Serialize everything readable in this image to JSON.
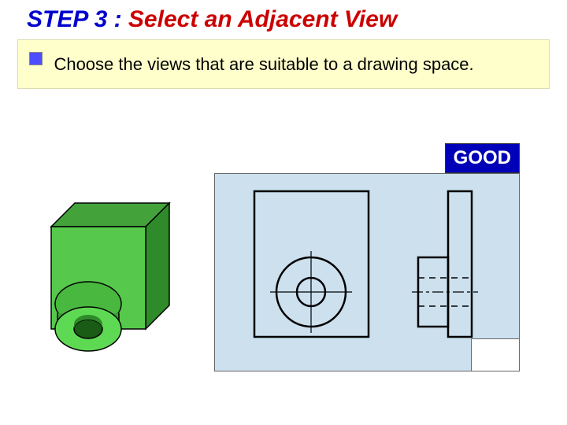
{
  "title": {
    "step": "STEP 3 : ",
    "rest": "Select an Adjacent  View"
  },
  "description": "Choose the views that are suitable to a drawing space.",
  "badge": "GOOD"
}
